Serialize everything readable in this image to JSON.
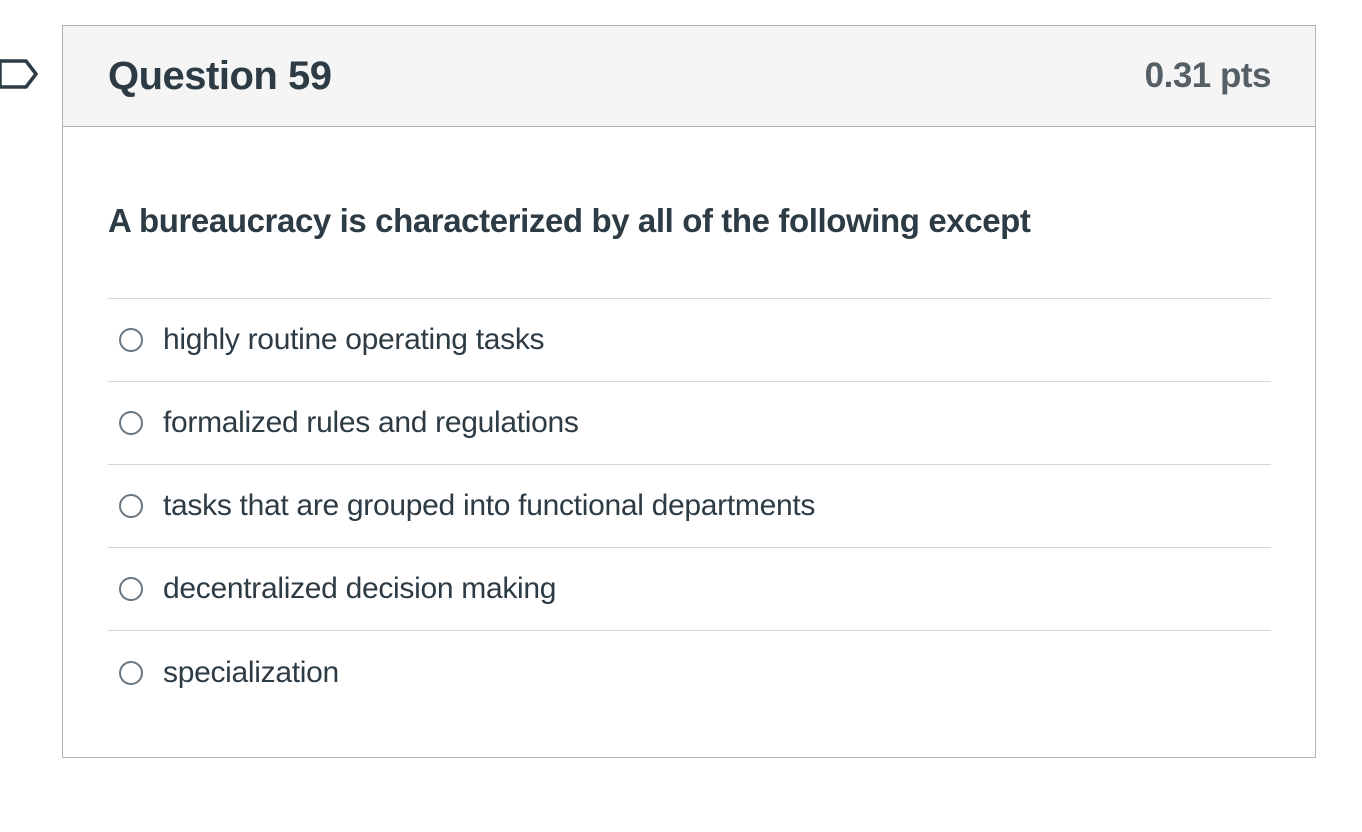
{
  "question": {
    "title": "Question 59",
    "points": "0.31 pts",
    "text": "A bureaucracy is characterized by all of the following except",
    "answers": [
      {
        "label": "highly routine operating tasks",
        "selected": false
      },
      {
        "label": "formalized rules and regulations",
        "selected": false
      },
      {
        "label": "tasks that are grouped into functional departments",
        "selected": false
      },
      {
        "label": "decentralized decision making",
        "selected": false
      },
      {
        "label": "specialization",
        "selected": false
      }
    ]
  },
  "flag": {
    "icon": "flag-bookmark-icon",
    "color": "#2d3b45"
  },
  "colors": {
    "header_bg": "#f5f5f5",
    "border": "#b3b3b3",
    "text": "#2d3b45",
    "points_text": "#555f66"
  }
}
